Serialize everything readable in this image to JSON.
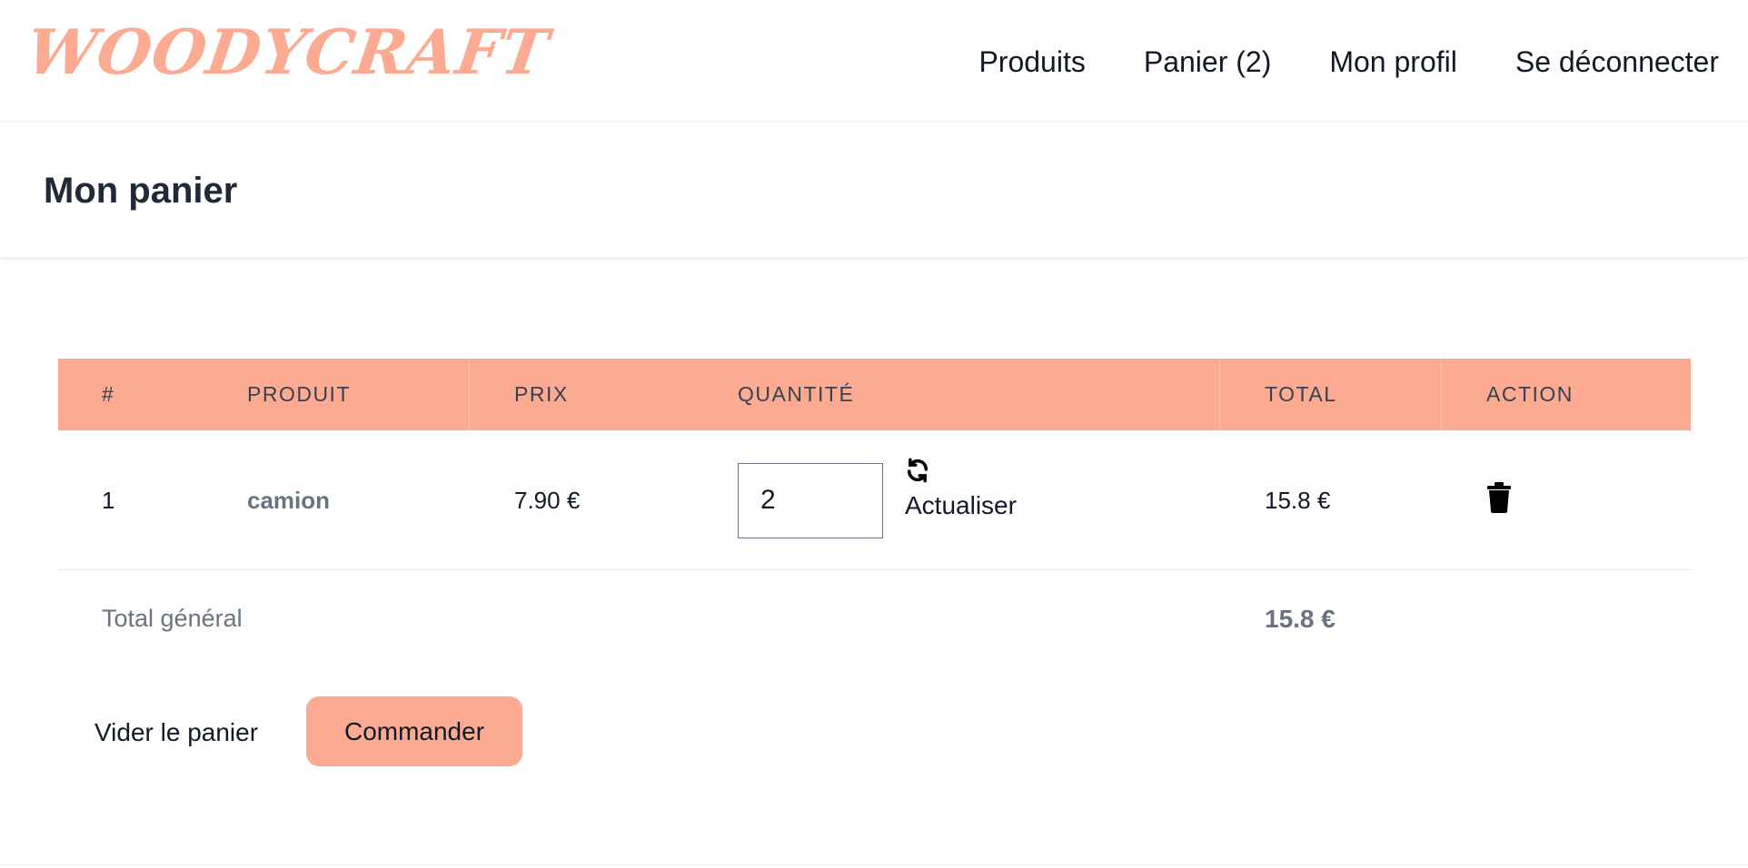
{
  "brand": {
    "logo_text": "WOODYCRAFT",
    "accent_color": "#fcab92"
  },
  "nav": {
    "items": [
      {
        "label": "Produits"
      },
      {
        "label": "Panier (2)"
      },
      {
        "label": "Mon profil"
      },
      {
        "label": "Se déconnecter"
      }
    ]
  },
  "header": {
    "title": "Mon panier"
  },
  "cart": {
    "columns": [
      "#",
      "PRODUIT",
      "PRIX",
      "QUANTITÉ",
      "TOTAL",
      "ACTION"
    ],
    "rows": [
      {
        "index": "1",
        "product": "camion",
        "price": "7.90 €",
        "quantity": "2",
        "refresh_label": "Actualiser",
        "refresh_icon": "refresh-icon",
        "total": "15.8 €",
        "delete_icon": "trash-icon"
      }
    ],
    "grand_total_label": "Total général",
    "grand_total_value": "15.8 €"
  },
  "actions": {
    "clear_label": "Vider le panier",
    "order_label": "Commander"
  }
}
